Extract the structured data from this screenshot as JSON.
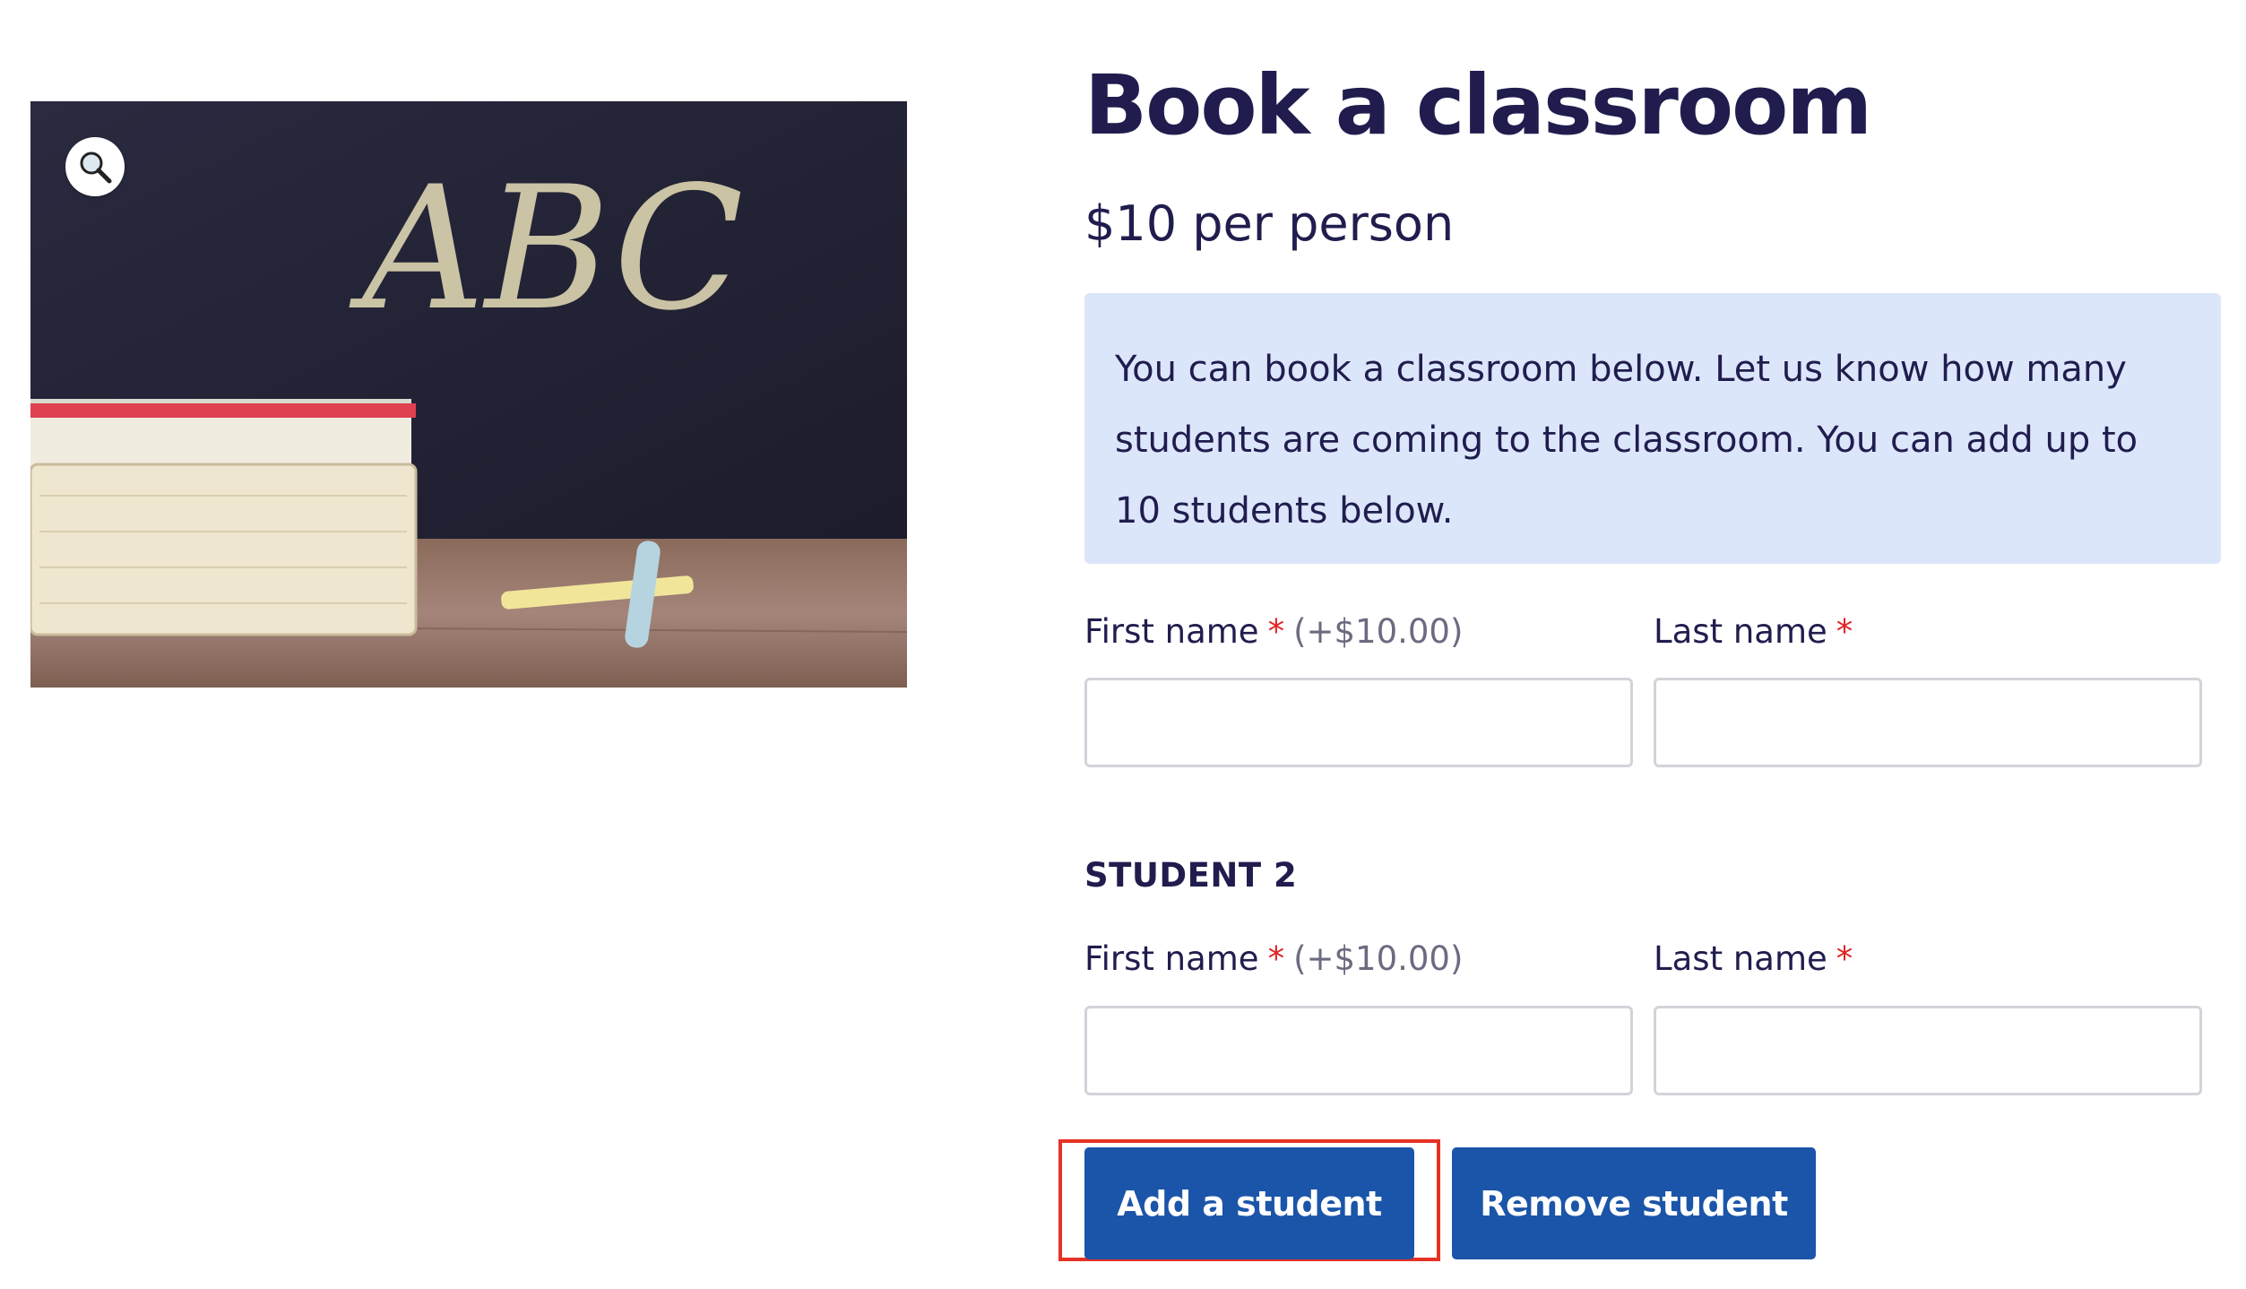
{
  "product": {
    "title": "Book a classroom",
    "price": "$10 per person",
    "image_icon": "zoom-magnifier-icon",
    "image_chalk_text": "ABC"
  },
  "notice": {
    "text": "You can book a classroom below. Let us know how many students are coming to the classroom. You can add up to 10 students below."
  },
  "students": [
    {
      "heading": "",
      "first_name": {
        "label": "First name",
        "required": "*",
        "extra": "(+$10.00)",
        "value": ""
      },
      "last_name": {
        "label": "Last name",
        "required": "*",
        "value": ""
      }
    },
    {
      "heading": "STUDENT 2",
      "first_name": {
        "label": "First name",
        "required": "*",
        "extra": "(+$10.00)",
        "value": ""
      },
      "last_name": {
        "label": "Last name",
        "required": "*",
        "value": ""
      }
    }
  ],
  "buttons": {
    "add": "Add a student",
    "remove": "Remove student"
  },
  "colors": {
    "title": "#201d4e",
    "notice_bg": "#dce6fb",
    "button": "#1b55a9",
    "required": "#e02424",
    "highlight": "#e53224"
  }
}
